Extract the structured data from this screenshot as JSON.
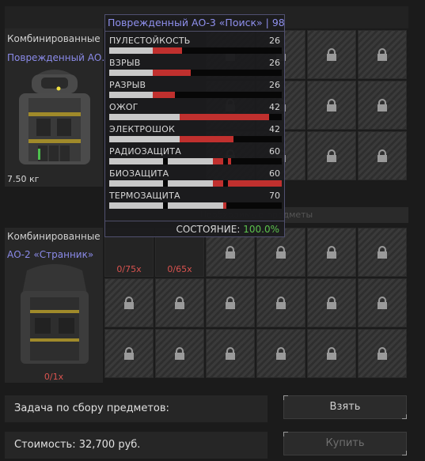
{
  "top_item": {
    "category": "Комбинированные",
    "name": "Поврежденный АО.",
    "weight": "7.50 кг"
  },
  "bottom_item": {
    "category": "Комбинированные",
    "name": "АО-2 «Странник»",
    "count": "0/1x"
  },
  "slots": [
    {
      "count": "0/75x"
    },
    {
      "count": "0/65x"
    }
  ],
  "sub_header_text": "Необходимые предметы",
  "tooltip": {
    "title": "Поврежденный АО-3 «Поиск» | 98",
    "stats": [
      {
        "label": "ПУЛЕСТОЙКОСТЬ",
        "value": "26"
      },
      {
        "label": "ВЗРЫВ",
        "value": "26"
      },
      {
        "label": "РАЗРЫВ",
        "value": "26"
      },
      {
        "label": "ОЖОГ",
        "value": "42"
      },
      {
        "label": "ЭЛЕКТРОШОК",
        "value": "42"
      },
      {
        "label": "РАДИОЗАЩИТА",
        "value": "60"
      },
      {
        "label": "БИОЗАЩИТА",
        "value": "60"
      },
      {
        "label": "ТЕРМОЗАЩИТА",
        "value": "70"
      }
    ],
    "state_label": "СОСТОЯНИЕ:",
    "state_value": "100.0%"
  },
  "task": {
    "label": "Задача по сбору предметов:"
  },
  "cost": {
    "label": "Стоимость: 32,700 руб."
  },
  "buttons": {
    "take": "Взять",
    "buy": "Купить"
  },
  "colors": {
    "bar_white": "#c8c8c8",
    "bar_red": "#c0302e",
    "title": "#8f90ee",
    "state_green": "#5cc24d",
    "count_red": "#d9534f"
  },
  "icons": [
    "lock-icon"
  ]
}
